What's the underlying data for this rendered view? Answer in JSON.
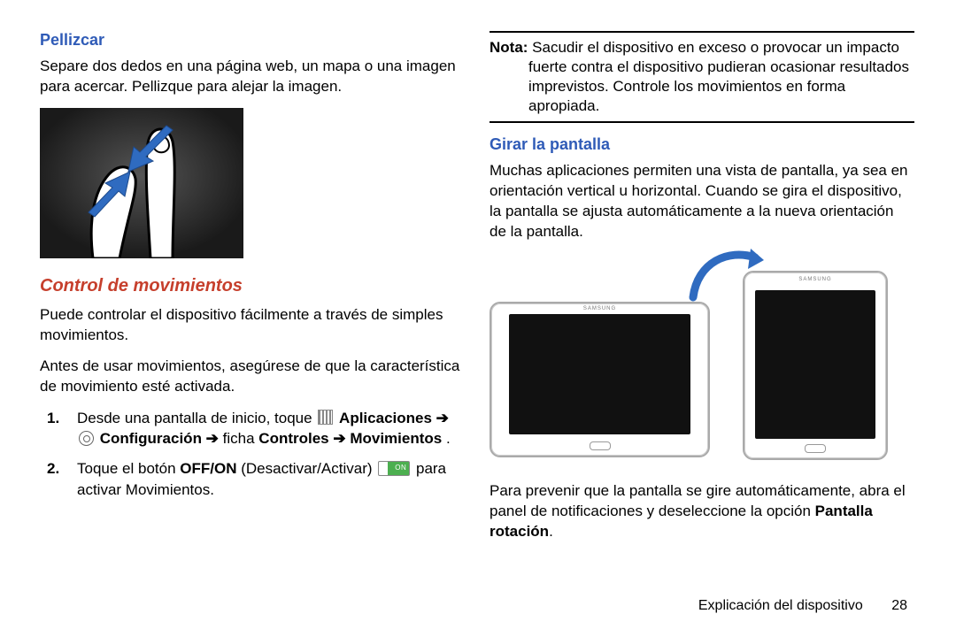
{
  "left": {
    "h_pellizcar": "Pellizcar",
    "p_pellizcar": "Separe dos dedos en una página web, un mapa o una imagen para acercar. Pellizque para alejar la imagen.",
    "h_control": "Control de movimientos",
    "p_control_1": "Puede controlar el dispositivo fácilmente a través de simples movimientos.",
    "p_control_2": "Antes de usar movimientos, asegúrese de que la característica de movimiento esté activada.",
    "step1_a": "Desde una pantalla de inicio, toque ",
    "step1_b": " Aplicaciones ➔",
    "step1_c": " Configuración ➔ ",
    "step1_d": "ficha",
    "step1_e": " Controles ➔ Movimientos",
    "step1_f": ".",
    "step2_a": "Toque el botón ",
    "step2_b": "OFF/ON",
    "step2_c": " (Desactivar/Activar) ",
    "step2_d": " para activar Movimientos."
  },
  "right": {
    "nota_label": "Nota:",
    "nota_text": " Sacudir el dispositivo en exceso o provocar un impacto fuerte contra el dispositivo pudieran ocasionar resultados imprevistos. Controle los movimientos en forma apropiada.",
    "h_girar": "Girar la pantalla",
    "p_girar": "Muchas aplicaciones permiten una vista de pantalla, ya sea en orientación vertical u horizontal. Cuando se gira el dispositivo, la pantalla se ajusta automáticamente a la nueva orientación de la pantalla.",
    "p_prevenir_a": "Para prevenir que la pantalla se gire automáticamente, abra el panel de notificaciones y deseleccione la opción ",
    "p_prevenir_b": "Pantalla rotación",
    "p_prevenir_c": ".",
    "tablet_brand": "SAMSUNG"
  },
  "num1": "1.",
  "num2": "2.",
  "footer_text": "Explicación del dispositivo",
  "footer_page": "28"
}
